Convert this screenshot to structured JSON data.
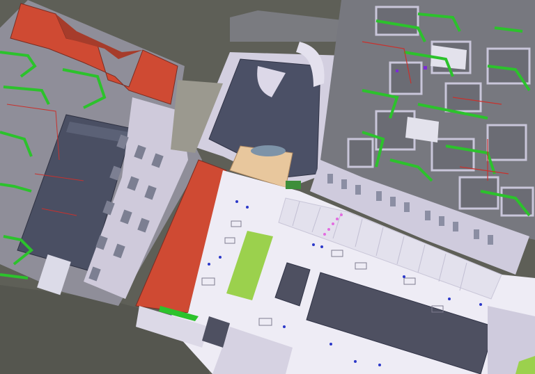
{
  "window": {
    "title": ""
  },
  "viewport": {
    "label": ""
  },
  "palette": {
    "ground": "#5e5f57",
    "facade_light": "#d9d6e6",
    "facade_mid": "#b9b6c9",
    "roof_dark": "#4a4f63",
    "roof_tile": "#cf4a33",
    "plaza": "#eeecf5",
    "grass": "#9bd14d",
    "glass_roof": "#e8c79d",
    "pipe_green": "#2cc22c",
    "pipe_red": "#c8312d",
    "wall_gray": "#77787f"
  },
  "layers": [
    "roof-tiles",
    "roof-slate",
    "facades",
    "courtyard",
    "plaza",
    "green-lawn",
    "mep-pipes"
  ]
}
